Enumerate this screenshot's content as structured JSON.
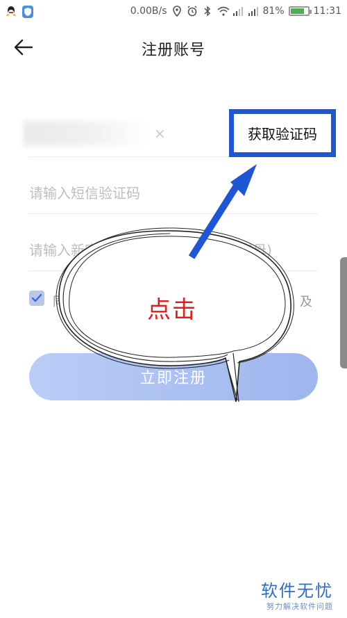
{
  "status_bar": {
    "network_speed": "0.00B/s",
    "battery_percent": "81%",
    "battery_level": 0.81,
    "time": "11:31",
    "icons": [
      "qq-icon",
      "shield-icon",
      "location-icon",
      "alarm-icon",
      "bluetooth-icon",
      "wifi-icon",
      "signal-icon",
      "signal-icon",
      "battery-icon"
    ]
  },
  "header": {
    "title": "注册账号",
    "back_icon": "back-arrow-icon"
  },
  "form": {
    "phone_clear_icon": "×",
    "get_code_label": "获取验证码",
    "sms_placeholder": "请输入短信验证码",
    "password_placeholder": "请输入新密",
    "password_suffix": "字母)",
    "agreement_prefix": "同",
    "agreement_suffix": "及",
    "register_label": "立即注册"
  },
  "annotation": {
    "callout_text": "点击",
    "highlight_color": "#1e56d6",
    "callout_text_color": "#e21b1b"
  },
  "watermark": {
    "title": "软件无忧",
    "subtitle": "努力解决软件问题"
  }
}
